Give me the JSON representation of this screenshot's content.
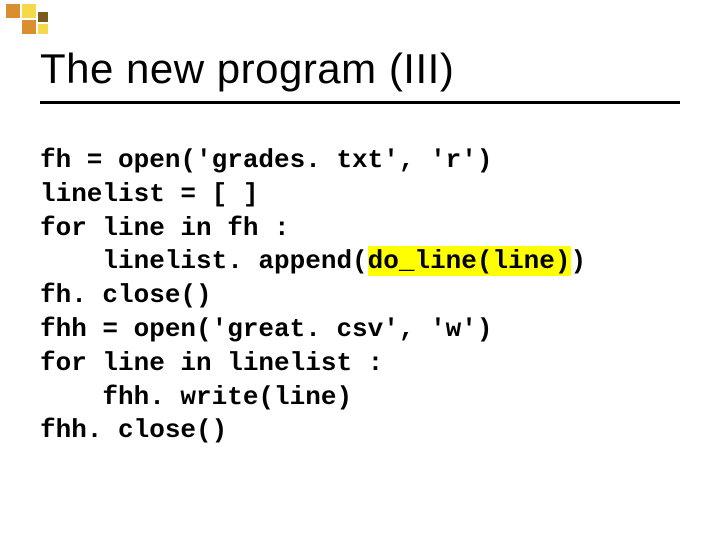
{
  "slide": {
    "title": "The new program (III)"
  },
  "decor_colors": {
    "orange": "#d98f2f",
    "yellow": "#f6d94a",
    "dark": "#7a5a1a"
  },
  "code": {
    "l1": "fh = open('grades. txt', 'r')",
    "l2": "linelist = [ ]",
    "l3": "for line in fh :",
    "l4a": "    linelist. append(",
    "l4b": "do_line(line)",
    "l4c": ")",
    "l5": "fh. close()",
    "l6": "fhh = open('great. csv', 'w')",
    "l7": "for line in linelist :",
    "l8": "    fhh. write(line)",
    "l9": "fhh. close()"
  }
}
